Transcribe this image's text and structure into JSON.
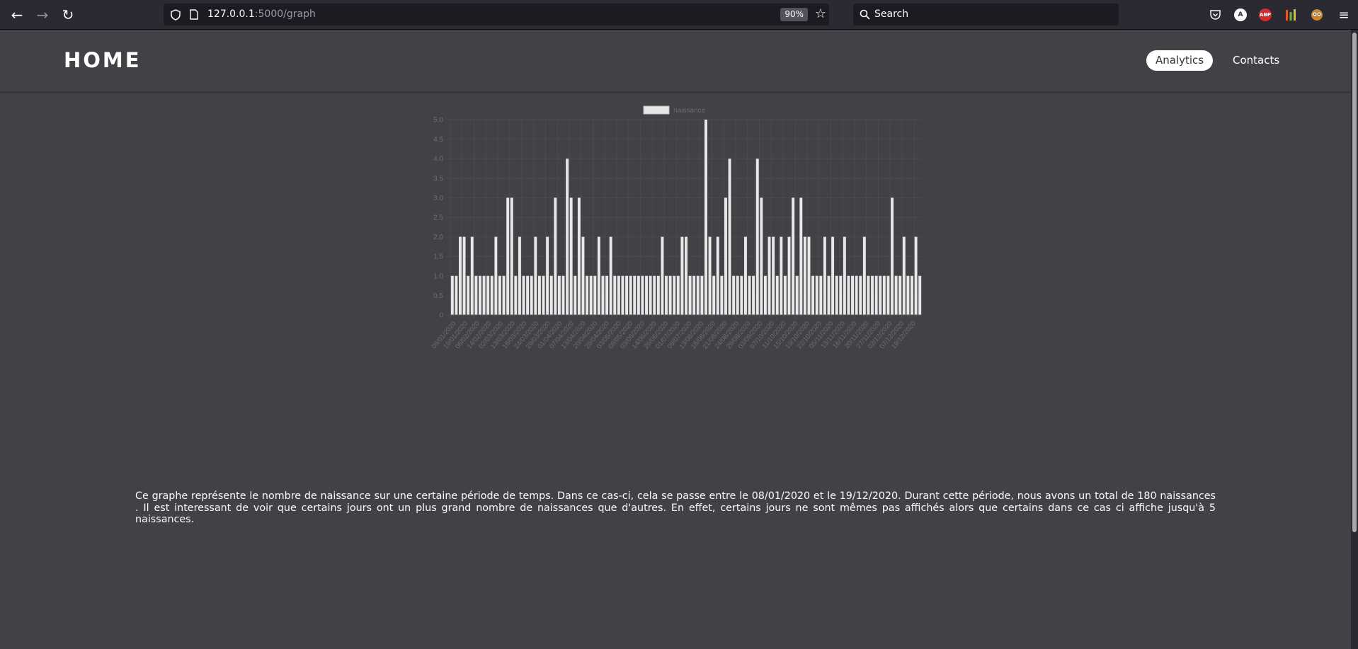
{
  "browser": {
    "url_host": "127.0.0.1",
    "url_path": ":5000/graph",
    "zoom": "90%",
    "search_placeholder": "Search",
    "ext_a": "A",
    "ext_abp": "ABP"
  },
  "header": {
    "brand": "HOME",
    "nav": [
      {
        "label": "Analytics",
        "active": true
      },
      {
        "label": "Contacts",
        "active": false
      }
    ]
  },
  "description": "Ce graphe représente le nombre de naissance sur une certaine période de temps. Dans ce cas-ci, cela se passe entre le 08/01/2020 et le 19/12/2020. Durant cette période, nous avons un total de 180 naissances . Il est interessant de voir que certains jours ont un plus grand nombre de naissances que d'autres. En effet, certains jours ne sont mêmes pas affichés alors que certains dans ce cas ci affiche jusqu'à 5 naissances.",
  "chart_data": {
    "type": "bar",
    "legend": [
      "naissance"
    ],
    "legend_position": "top",
    "grid": true,
    "ylim": [
      0,
      5
    ],
    "yticks": [
      "0",
      "0.5",
      "1.0",
      "1.5",
      "2.0",
      "2.5",
      "3.0",
      "3.5",
      "4.0",
      "4.5",
      "5.0"
    ],
    "series": [
      {
        "name": "naissance",
        "values": [
          1,
          1,
          2,
          2,
          1,
          2,
          1,
          1,
          1,
          1,
          1,
          2,
          1,
          1,
          3,
          3,
          1,
          2,
          1,
          1,
          1,
          2,
          1,
          1,
          2,
          1,
          3,
          1,
          1,
          4,
          3,
          1,
          3,
          2,
          1,
          1,
          1,
          2,
          1,
          1,
          2,
          1,
          1,
          1,
          1,
          1,
          1,
          1,
          1,
          1,
          1,
          1,
          1,
          2,
          1,
          1,
          1,
          1,
          2,
          2,
          1,
          1,
          1,
          1,
          5,
          2,
          1,
          2,
          1,
          3,
          4,
          1,
          1,
          1,
          2,
          1,
          1,
          4,
          3,
          1,
          2,
          2,
          1,
          2,
          1,
          2,
          3,
          1,
          3,
          2,
          2,
          1,
          1,
          1,
          2,
          1,
          2,
          1,
          1,
          2,
          1,
          1,
          1,
          1,
          2,
          1,
          1,
          1,
          1,
          1,
          1,
          3,
          1,
          1,
          2,
          1,
          1,
          2,
          1
        ]
      }
    ],
    "tick_labels": [
      "08/01/2020",
      "19/01/2020",
      "06/02/2020",
      "14/02/2020",
      "02/03/2020",
      "13/03/2020",
      "18/03/2020",
      "24/03/2020",
      "29/03/2020",
      "01/04/2020",
      "07/04/2020",
      "13/04/2020",
      "20/04/2020",
      "29/04/2020",
      "03/05/2020",
      "08/05/2020",
      "03/06/2020",
      "14/06/2020",
      "26/06/2020",
      "01/07/2020",
      "09/07/2020",
      "13/08/2020",
      "18/08/2020",
      "21/08/2020",
      "24/08/2020",
      "29/08/2020",
      "03/09/2020",
      "07/10/2020",
      "11/10/2020",
      "15/10/2020",
      "19/10/2020",
      "22/10/2020",
      "05/11/2020",
      "13/11/2020",
      "16/11/2020",
      "20/11/2020",
      "27/11/2020",
      "02/12/2020",
      "07/12/2020",
      "19/12/2020"
    ]
  }
}
